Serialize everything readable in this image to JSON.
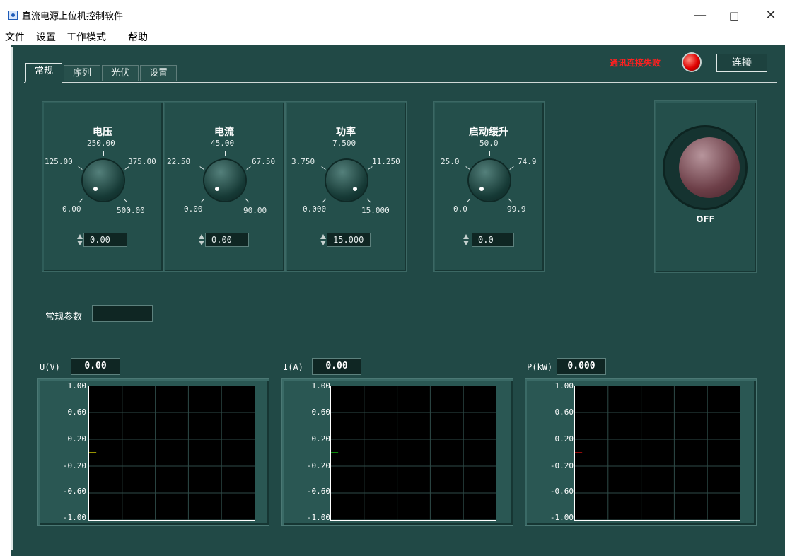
{
  "window": {
    "title": "直流电源上位机控制软件",
    "controls": {
      "minimize": "—",
      "maximize": "□",
      "close": "✕"
    }
  },
  "menu": [
    "文件",
    "设置",
    "工作模式",
    "帮助"
  ],
  "tabs": [
    {
      "label": "常规",
      "active": true
    },
    {
      "label": "序列",
      "active": false
    },
    {
      "label": "光伏",
      "active": false
    },
    {
      "label": "设置",
      "active": false
    }
  ],
  "status": {
    "text": "通讯连接失败",
    "led_color": "#e00000"
  },
  "connect_button": "连接",
  "knobs": [
    {
      "title": "电压",
      "labels": [
        "0.00",
        "125.00",
        "250.00",
        "375.00",
        "500.00"
      ],
      "value": "0.00"
    },
    {
      "title": "电流",
      "labels": [
        "0.00",
        "22.50",
        "45.00",
        "67.50",
        "90.00"
      ],
      "value": "0.00"
    },
    {
      "title": "功率",
      "labels": [
        "0.000",
        "3.750",
        "7.500",
        "11.250",
        "15.000"
      ],
      "value": "15.000"
    },
    {
      "title": "启动缓升",
      "labels": [
        "0.0",
        "25.0",
        "50.0",
        "74.9",
        "99.9"
      ],
      "value": "0.0"
    }
  ],
  "power_button": {
    "label": "OFF"
  },
  "params": {
    "label": "常规参数",
    "value": ""
  },
  "meters": [
    {
      "label": "U(V)",
      "value": "0.00",
      "trace_color": "#e8e000"
    },
    {
      "label": "I(A)",
      "value": "0.00",
      "trace_color": "#10d010"
    },
    {
      "label": "P(kW)",
      "value": "0.000",
      "trace_color": "#e01010"
    }
  ],
  "chart_data": [
    {
      "type": "line",
      "title": "",
      "xlabel": "",
      "ylabel": "",
      "ylim": [
        -1.0,
        1.0
      ],
      "yticks": [
        "1.00",
        "0.60",
        "0.20",
        "-0.20",
        "-0.60",
        "-1.00"
      ],
      "grid": true,
      "series": [
        {
          "x": [
            0,
            1
          ],
          "values": [
            0,
            0
          ]
        }
      ]
    },
    {
      "type": "line",
      "title": "",
      "xlabel": "",
      "ylabel": "",
      "ylim": [
        -1.0,
        1.0
      ],
      "yticks": [
        "1.00",
        "0.60",
        "0.20",
        "-0.20",
        "-0.60",
        "-1.00"
      ],
      "grid": true,
      "series": [
        {
          "x": [
            0,
            1
          ],
          "values": [
            0,
            0
          ]
        }
      ]
    },
    {
      "type": "line",
      "title": "",
      "xlabel": "",
      "ylabel": "",
      "ylim": [
        -1.0,
        1.0
      ],
      "yticks": [
        "1.00",
        "0.60",
        "0.20",
        "-0.20",
        "-0.60",
        "-1.00"
      ],
      "grid": true,
      "series": [
        {
          "x": [
            0,
            1
          ],
          "values": [
            0,
            0
          ]
        }
      ]
    }
  ]
}
